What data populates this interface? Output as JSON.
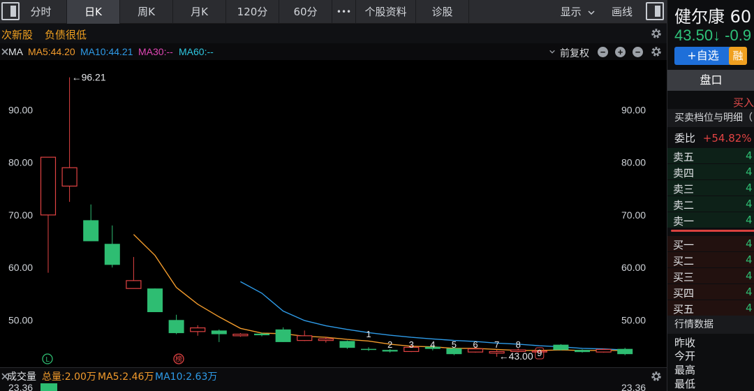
{
  "toolbar": {
    "tabs": [
      "分时",
      "日K",
      "周K",
      "月K",
      "120分",
      "60分",
      "•••",
      "个股资料",
      "诊股"
    ],
    "active_tab": "日K",
    "display_label": "显示",
    "draw_label": "画线"
  },
  "tags": [
    "次新股",
    "负债很低"
  ],
  "ma_row": {
    "label": "MA",
    "ma5": "MA5:44.20",
    "ma10": "MA10:44.21",
    "ma30": "MA30:--",
    "ma60": "MA60:--",
    "adjust": "前复权",
    "colors": {
      "ma5": "#f29b2c",
      "ma10": "#2e9be8",
      "ma30": "#e046b5",
      "ma60": "#2ec7e0",
      "up": "#e24343",
      "down": "#2ebd72"
    }
  },
  "chart_data": {
    "type": "candlestick",
    "y_ticks": [
      "90.00",
      "80.00",
      "70.00",
      "60.00",
      "50.00"
    ],
    "ylim": [
      41,
      99.5
    ],
    "candles": [
      {
        "o": 70.0,
        "c": 81.0,
        "h": 81.0,
        "l": 59.0
      },
      {
        "o": 75.5,
        "c": 79.0,
        "h": 96.21,
        "l": 72.5
      },
      {
        "o": 69.0,
        "c": 65.0,
        "h": 72.0,
        "l": 65.0
      },
      {
        "o": 64.5,
        "c": 60.5,
        "h": 68.0,
        "l": 60.0
      },
      {
        "o": 56.0,
        "c": 57.5,
        "h": 62.0,
        "l": 56.0
      },
      {
        "o": 56.0,
        "c": 51.5,
        "h": 56.0,
        "l": 51.5
      },
      {
        "o": 50.0,
        "c": 47.5,
        "h": 51.0,
        "l": 47.3
      },
      {
        "o": 47.8,
        "c": 48.5,
        "h": 49.0,
        "l": 47.0
      },
      {
        "o": 48.0,
        "c": 47.3,
        "h": 48.2,
        "l": 45.8
      },
      {
        "o": 47.0,
        "c": 47.3,
        "h": 47.5,
        "l": 46.8
      },
      {
        "o": 47.4,
        "c": 47.1,
        "h": 47.6,
        "l": 46.9
      },
      {
        "o": 48.2,
        "c": 45.8,
        "h": 48.6,
        "l": 45.8
      },
      {
        "o": 46.1,
        "c": 47.0,
        "h": 48.0,
        "l": 46.0
      },
      {
        "o": 46.1,
        "c": 46.4,
        "h": 46.8,
        "l": 45.7
      },
      {
        "o": 46.0,
        "c": 44.7,
        "h": 46.1,
        "l": 44.5
      },
      {
        "o": 44.5,
        "c": 44.4,
        "h": 44.8,
        "l": 44.1
      },
      {
        "o": 44.3,
        "c": 44.0,
        "h": 44.5,
        "l": 43.8
      },
      {
        "o": 44.0,
        "c": 44.8,
        "h": 45.3,
        "l": 43.9
      },
      {
        "o": 44.9,
        "c": 44.5,
        "h": 45.1,
        "l": 44.2
      },
      {
        "o": 44.6,
        "c": 43.5,
        "h": 44.8,
        "l": 43.3
      },
      {
        "o": 43.9,
        "c": 44.5,
        "h": 45.0,
        "l": 43.8
      },
      {
        "o": 43.7,
        "c": 44.0,
        "h": 44.3,
        "l": 43.0
      },
      {
        "o": 44.0,
        "c": 44.3,
        "h": 44.6,
        "l": 43.8
      },
      {
        "o": 44.0,
        "c": 44.1,
        "h": 44.4,
        "l": 43.9
      },
      {
        "o": 45.3,
        "c": 44.3,
        "h": 45.4,
        "l": 44.2
      },
      {
        "o": 44.3,
        "c": 43.9,
        "h": 44.4,
        "l": 43.8
      },
      {
        "o": 43.9,
        "c": 44.4,
        "h": 44.6,
        "l": 43.8
      },
      {
        "o": 44.5,
        "c": 43.5,
        "h": 44.7,
        "l": 43.3
      }
    ],
    "ma5": [
      null,
      null,
      null,
      null,
      66.3,
      62.3,
      56.2,
      53.0,
      50.6,
      48.4,
      47.5,
      47.4,
      46.9,
      46.7,
      46.3,
      46.0,
      45.4,
      45.0,
      44.9,
      44.6,
      44.6,
      44.4,
      44.2,
      44.2,
      44.3,
      44.2,
      44.2,
      44.2
    ],
    "ma10": [
      null,
      null,
      null,
      null,
      null,
      null,
      null,
      null,
      null,
      57.3,
      55.1,
      51.7,
      49.9,
      48.9,
      48.2,
      47.6,
      47.1,
      46.7,
      46.4,
      46.1,
      45.9,
      45.6,
      45.4,
      45.1,
      44.9,
      44.6,
      44.5,
      44.3
    ],
    "high_label": "←96.21",
    "low_label": "←43.00",
    "candle_markers": [
      {
        "index": 15,
        "text": "1"
      },
      {
        "index": 16,
        "text": "2"
      },
      {
        "index": 17,
        "text": "3"
      },
      {
        "index": 18,
        "text": "4"
      },
      {
        "index": 19,
        "text": "5"
      },
      {
        "index": 20,
        "text": "6"
      },
      {
        "index": 21,
        "text": "7"
      },
      {
        "index": 22,
        "text": "8"
      },
      {
        "index": 23,
        "text": "9"
      }
    ],
    "badges": [
      {
        "index": 2,
        "text": "L"
      },
      {
        "index": 8,
        "text": "榜"
      }
    ]
  },
  "volume": {
    "label": "成交量",
    "total": "总量:2.00万",
    "ma5": "MA5:2.46万",
    "ma10": "MA10:2.63万",
    "axis_value": "23.36"
  },
  "right": {
    "name": "健尔康 60",
    "price": "43.50↓ -0.9",
    "add_btn": "+自选",
    "rong": "融",
    "pankou": "盘口",
    "buyin": "买入",
    "sub": "买卖档位与明细（",
    "weibi_label": "委比",
    "weibi_value": "+54.82%",
    "sells": [
      {
        "label": "卖五",
        "value": "4"
      },
      {
        "label": "卖四",
        "value": "4"
      },
      {
        "label": "卖三",
        "value": "4"
      },
      {
        "label": "卖二",
        "value": "4"
      },
      {
        "label": "卖一",
        "value": "4"
      }
    ],
    "buys": [
      {
        "label": "买一",
        "value": "4"
      },
      {
        "label": "买二",
        "value": "4"
      },
      {
        "label": "买三",
        "value": "4"
      },
      {
        "label": "买四",
        "value": "4"
      },
      {
        "label": "买五",
        "value": "4"
      }
    ],
    "hangqing": "行情数据",
    "stats": [
      "昨收",
      "今开",
      "最高",
      "最低"
    ]
  }
}
